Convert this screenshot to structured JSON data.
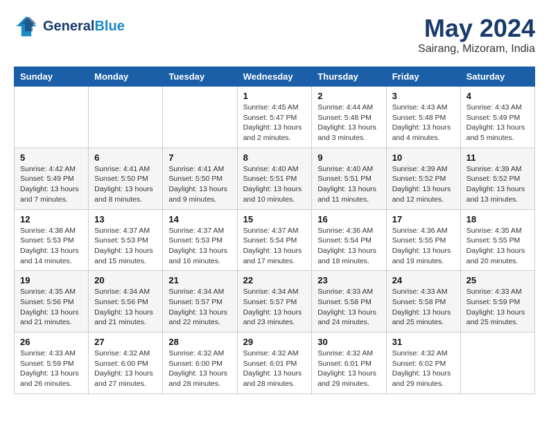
{
  "header": {
    "logo_line1": "General",
    "logo_line2": "Blue",
    "month": "May 2024",
    "location": "Sairang, Mizoram, India"
  },
  "weekdays": [
    "Sunday",
    "Monday",
    "Tuesday",
    "Wednesday",
    "Thursday",
    "Friday",
    "Saturday"
  ],
  "weeks": [
    [
      {
        "day": "",
        "info": ""
      },
      {
        "day": "",
        "info": ""
      },
      {
        "day": "",
        "info": ""
      },
      {
        "day": "1",
        "info": "Sunrise: 4:45 AM\nSunset: 5:47 PM\nDaylight: 13 hours and 2 minutes."
      },
      {
        "day": "2",
        "info": "Sunrise: 4:44 AM\nSunset: 5:48 PM\nDaylight: 13 hours and 3 minutes."
      },
      {
        "day": "3",
        "info": "Sunrise: 4:43 AM\nSunset: 5:48 PM\nDaylight: 13 hours and 4 minutes."
      },
      {
        "day": "4",
        "info": "Sunrise: 4:43 AM\nSunset: 5:49 PM\nDaylight: 13 hours and 5 minutes."
      }
    ],
    [
      {
        "day": "5",
        "info": "Sunrise: 4:42 AM\nSunset: 5:49 PM\nDaylight: 13 hours and 7 minutes."
      },
      {
        "day": "6",
        "info": "Sunrise: 4:41 AM\nSunset: 5:50 PM\nDaylight: 13 hours and 8 minutes."
      },
      {
        "day": "7",
        "info": "Sunrise: 4:41 AM\nSunset: 5:50 PM\nDaylight: 13 hours and 9 minutes."
      },
      {
        "day": "8",
        "info": "Sunrise: 4:40 AM\nSunset: 5:51 PM\nDaylight: 13 hours and 10 minutes."
      },
      {
        "day": "9",
        "info": "Sunrise: 4:40 AM\nSunset: 5:51 PM\nDaylight: 13 hours and 11 minutes."
      },
      {
        "day": "10",
        "info": "Sunrise: 4:39 AM\nSunset: 5:52 PM\nDaylight: 13 hours and 12 minutes."
      },
      {
        "day": "11",
        "info": "Sunrise: 4:39 AM\nSunset: 5:52 PM\nDaylight: 13 hours and 13 minutes."
      }
    ],
    [
      {
        "day": "12",
        "info": "Sunrise: 4:38 AM\nSunset: 5:53 PM\nDaylight: 13 hours and 14 minutes."
      },
      {
        "day": "13",
        "info": "Sunrise: 4:37 AM\nSunset: 5:53 PM\nDaylight: 13 hours and 15 minutes."
      },
      {
        "day": "14",
        "info": "Sunrise: 4:37 AM\nSunset: 5:53 PM\nDaylight: 13 hours and 16 minutes."
      },
      {
        "day": "15",
        "info": "Sunrise: 4:37 AM\nSunset: 5:54 PM\nDaylight: 13 hours and 17 minutes."
      },
      {
        "day": "16",
        "info": "Sunrise: 4:36 AM\nSunset: 5:54 PM\nDaylight: 13 hours and 18 minutes."
      },
      {
        "day": "17",
        "info": "Sunrise: 4:36 AM\nSunset: 5:55 PM\nDaylight: 13 hours and 19 minutes."
      },
      {
        "day": "18",
        "info": "Sunrise: 4:35 AM\nSunset: 5:55 PM\nDaylight: 13 hours and 20 minutes."
      }
    ],
    [
      {
        "day": "19",
        "info": "Sunrise: 4:35 AM\nSunset: 5:56 PM\nDaylight: 13 hours and 21 minutes."
      },
      {
        "day": "20",
        "info": "Sunrise: 4:34 AM\nSunset: 5:56 PM\nDaylight: 13 hours and 21 minutes."
      },
      {
        "day": "21",
        "info": "Sunrise: 4:34 AM\nSunset: 5:57 PM\nDaylight: 13 hours and 22 minutes."
      },
      {
        "day": "22",
        "info": "Sunrise: 4:34 AM\nSunset: 5:57 PM\nDaylight: 13 hours and 23 minutes."
      },
      {
        "day": "23",
        "info": "Sunrise: 4:33 AM\nSunset: 5:58 PM\nDaylight: 13 hours and 24 minutes."
      },
      {
        "day": "24",
        "info": "Sunrise: 4:33 AM\nSunset: 5:58 PM\nDaylight: 13 hours and 25 minutes."
      },
      {
        "day": "25",
        "info": "Sunrise: 4:33 AM\nSunset: 5:59 PM\nDaylight: 13 hours and 25 minutes."
      }
    ],
    [
      {
        "day": "26",
        "info": "Sunrise: 4:33 AM\nSunset: 5:59 PM\nDaylight: 13 hours and 26 minutes."
      },
      {
        "day": "27",
        "info": "Sunrise: 4:32 AM\nSunset: 6:00 PM\nDaylight: 13 hours and 27 minutes."
      },
      {
        "day": "28",
        "info": "Sunrise: 4:32 AM\nSunset: 6:00 PM\nDaylight: 13 hours and 28 minutes."
      },
      {
        "day": "29",
        "info": "Sunrise: 4:32 AM\nSunset: 6:01 PM\nDaylight: 13 hours and 28 minutes."
      },
      {
        "day": "30",
        "info": "Sunrise: 4:32 AM\nSunset: 6:01 PM\nDaylight: 13 hours and 29 minutes."
      },
      {
        "day": "31",
        "info": "Sunrise: 4:32 AM\nSunset: 6:02 PM\nDaylight: 13 hours and 29 minutes."
      },
      {
        "day": "",
        "info": ""
      }
    ]
  ]
}
